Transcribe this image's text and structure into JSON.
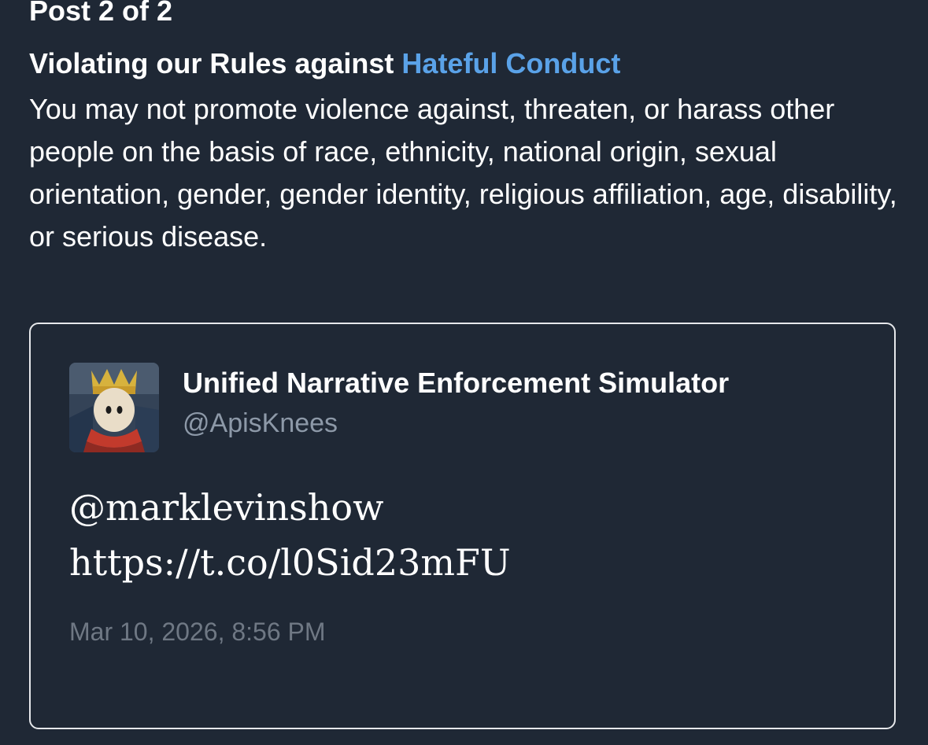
{
  "header": {
    "post_counter": "Post 2 of 2"
  },
  "violation": {
    "heading_prefix": "Violating our Rules against ",
    "rule_link": "Hateful Conduct",
    "description": "You may not promote violence against, threaten, or harass other people on the basis of race, ethnicity, national origin, sexual orientation, gender, gender identity, religious affiliation, age, disability, or serious disease."
  },
  "tweet": {
    "display_name": "Unified Narrative Enforcement Simulator",
    "handle": "@ApisKnees",
    "text_lines": [
      "@marklevinshow",
      "https://t.co/l0Sid23mFU"
    ],
    "timestamp": "Mar 10, 2026, 8:56 PM"
  },
  "colors": {
    "background": "#1f2835",
    "link": "#5aa2e8",
    "card_border": "#e6e8eb",
    "handle": "#8d99a8",
    "timestamp": "#6f7884"
  },
  "icons": {
    "avatar": "profile-avatar-image"
  }
}
